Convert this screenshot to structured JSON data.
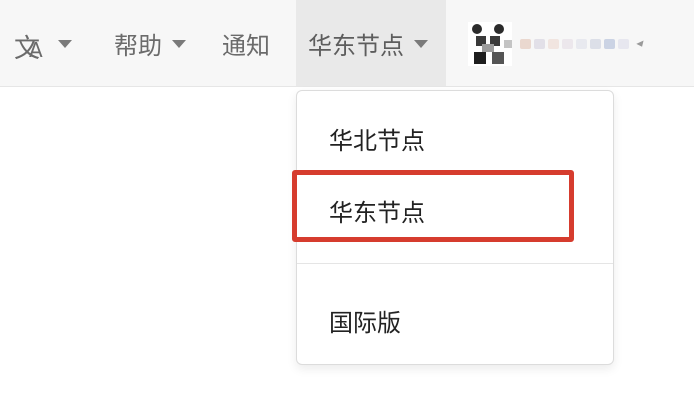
{
  "header": {
    "language_icon": "translate-icon",
    "help_label": "帮助",
    "notifications_label": "通知",
    "region_label": "华东节点"
  },
  "region_dropdown": {
    "items": [
      {
        "label": "华北节点"
      },
      {
        "label": "华东节点"
      },
      {
        "label": "国际版"
      }
    ],
    "highlighted_index": 1
  },
  "colors": {
    "topbar_bg": "#f7f7f7",
    "active_nav_bg": "#e9e9e9",
    "highlight_border": "#d63c2e"
  }
}
